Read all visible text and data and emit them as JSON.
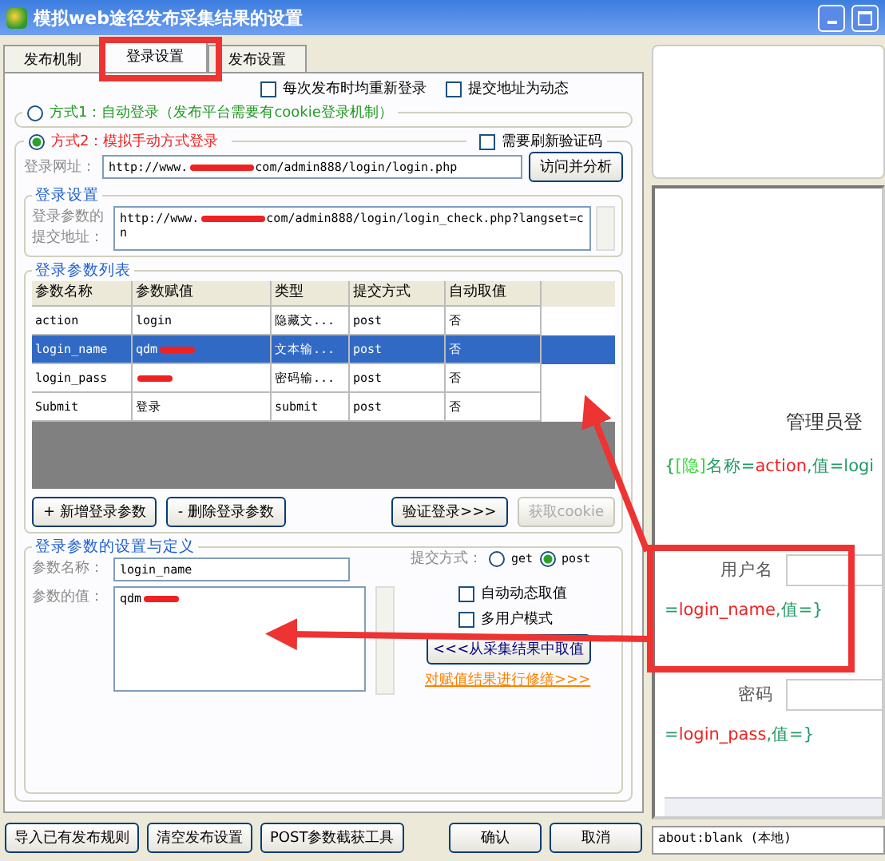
{
  "window": {
    "title": "模拟web途径发布采集结果的设置"
  },
  "tabs": [
    {
      "label": "发布机制",
      "selected": false
    },
    {
      "label": "登录设置",
      "selected": true
    },
    {
      "label": "发布设置",
      "selected": false
    }
  ],
  "options": [
    {
      "label": "每次发布时均重新登录",
      "checked": false
    },
    {
      "label": "提交地址为动态",
      "checked": false
    }
  ],
  "mode1": {
    "label": "方式1：自动登录（发布平台需要有cookie登录机制）",
    "selected": false
  },
  "mode2": {
    "label": "方式2：模拟手动方式登录",
    "selected": true,
    "captcha": {
      "label": "需要刷新验证码",
      "checked": false
    },
    "url_label": "登录网址：",
    "url": {
      "before": "http://www.",
      "after": "com/admin888/login/login.php",
      "redacted": true
    },
    "visit_button": "访问并分析"
  },
  "login_settings": {
    "title": "登录设置",
    "label": "登录参数的提交地址：",
    "url": {
      "before": "http://www.",
      "after": "com/admin888/login/login_check.php?langset=cn",
      "redacted": true
    }
  },
  "param_list": {
    "title": "登录参数列表",
    "columns": [
      "参数名称",
      "参数赋值",
      "类型",
      "提交方式",
      "自动取值"
    ],
    "rows": [
      {
        "selected": false,
        "cells": [
          {
            "text": "action"
          },
          {
            "text": "login"
          },
          {
            "text": "隐藏文..."
          },
          {
            "text": "post"
          },
          {
            "text": "否"
          }
        ]
      },
      {
        "selected": true,
        "cells": [
          {
            "text": "login_name"
          },
          {
            "text": "qdm",
            "redacted": true
          },
          {
            "text": "文本输..."
          },
          {
            "text": "post"
          },
          {
            "text": "否"
          }
        ]
      },
      {
        "selected": false,
        "cells": [
          {
            "text": "login_pass"
          },
          {
            "text": "",
            "redacted": true
          },
          {
            "text": "密码输..."
          },
          {
            "text": "post"
          },
          {
            "text": "否"
          }
        ]
      },
      {
        "selected": false,
        "cells": [
          {
            "text": "Submit"
          },
          {
            "text": "登录"
          },
          {
            "text": "submit"
          },
          {
            "text": "post"
          },
          {
            "text": "否"
          }
        ]
      }
    ],
    "buttons": [
      {
        "label": "+ 新增登录参数",
        "disabled": false
      },
      {
        "label": "- 删除登录参数",
        "disabled": false
      },
      {
        "label": "验证登录>>>",
        "disabled": false
      },
      {
        "label": "获取cookie",
        "disabled": true
      }
    ]
  },
  "param_def": {
    "title": "登录参数的设置与定义",
    "name_label": "参数名称：",
    "name_value": "login_name",
    "method_label": "提交方式：",
    "methods": [
      {
        "label": "get",
        "selected": false
      },
      {
        "label": "post",
        "selected": true
      }
    ],
    "value_label": "参数的值：",
    "value": {
      "before": "qdm",
      "redacted": true
    },
    "checks": [
      {
        "label": "自动动态取值",
        "checked": false
      },
      {
        "label": "多用户模式",
        "checked": false
      }
    ],
    "pick_button": "<<<从采集结果中取值",
    "fix_link": "对赋值结果进行修缮>>>"
  },
  "footer_buttons": [
    "导入已有发布规则",
    "清空发布设置",
    "POST参数截获工具",
    "确认",
    "取消"
  ],
  "browser": {
    "heading": "管理员登",
    "hidden_line": [
      {
        "text": "{",
        "color": "#22aa44"
      },
      {
        "text": "[隐]",
        "color": "#33dd33"
      },
      {
        "text": "名称=",
        "color": "#229966"
      },
      {
        "text": "action",
        "color": "#ee2222"
      },
      {
        "text": ",值=",
        "color": "#229966"
      },
      {
        "text": "logi",
        "color": "#229966"
      }
    ],
    "fields": [
      {
        "label": "用户名",
        "tag": [
          {
            "text": "=",
            "color": "#229966"
          },
          {
            "text": "login_name",
            "color": "#ee2222"
          },
          {
            "text": ",值=}",
            "color": "#229966"
          }
        ]
      },
      {
        "label": "密码",
        "tag": [
          {
            "text": "=",
            "color": "#229966"
          },
          {
            "text": "login_pass",
            "color": "#ee2222"
          },
          {
            "text": ",值=}",
            "color": "#229966"
          }
        ]
      }
    ],
    "status": "about:blank  (本地)"
  }
}
